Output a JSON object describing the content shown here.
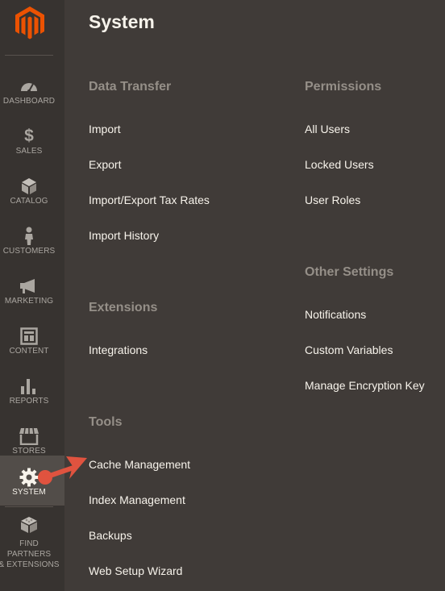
{
  "sidebar": {
    "items": [
      {
        "label": "DASHBOARD",
        "icon": "dashboard-icon"
      },
      {
        "label": "SALES",
        "icon": "dollar-icon"
      },
      {
        "label": "CATALOG",
        "icon": "cube-icon"
      },
      {
        "label": "CUSTOMERS",
        "icon": "person-icon"
      },
      {
        "label": "MARKETING",
        "icon": "megaphone-icon"
      },
      {
        "label": "CONTENT",
        "icon": "layout-icon"
      },
      {
        "label": "REPORTS",
        "icon": "bar-chart-icon"
      },
      {
        "label": "STORES",
        "icon": "storefront-icon"
      },
      {
        "label": "SYSTEM",
        "icon": "gear-icon",
        "active": true
      },
      {
        "label": "FIND PARTNERS & EXTENSIONS",
        "line1": "FIND PARTNERS",
        "line2": "& EXTENSIONS",
        "icon": "blocks-icon"
      }
    ]
  },
  "panel": {
    "title": "System",
    "sections": {
      "data_transfer": {
        "title": "Data Transfer",
        "links": [
          "Import",
          "Export",
          "Import/Export Tax Rates",
          "Import History"
        ]
      },
      "extensions": {
        "title": "Extensions",
        "links": [
          "Integrations"
        ]
      },
      "tools": {
        "title": "Tools",
        "links": [
          "Cache Management",
          "Index Management",
          "Backups",
          "Web Setup Wizard"
        ]
      },
      "permissions": {
        "title": "Permissions",
        "links": [
          "All Users",
          "Locked Users",
          "User Roles"
        ]
      },
      "other_settings": {
        "title": "Other Settings",
        "links": [
          "Notifications",
          "Custom Variables",
          "Manage Encryption Key"
        ]
      }
    }
  },
  "colors": {
    "sidebar_bg": "#373330",
    "panel_bg": "#403b38",
    "active_bg": "#524d49",
    "logo_orange": "#eb5202",
    "arrow_red": "#e0533f",
    "text_light": "#f7f3eb",
    "section_gray": "#958f88"
  }
}
